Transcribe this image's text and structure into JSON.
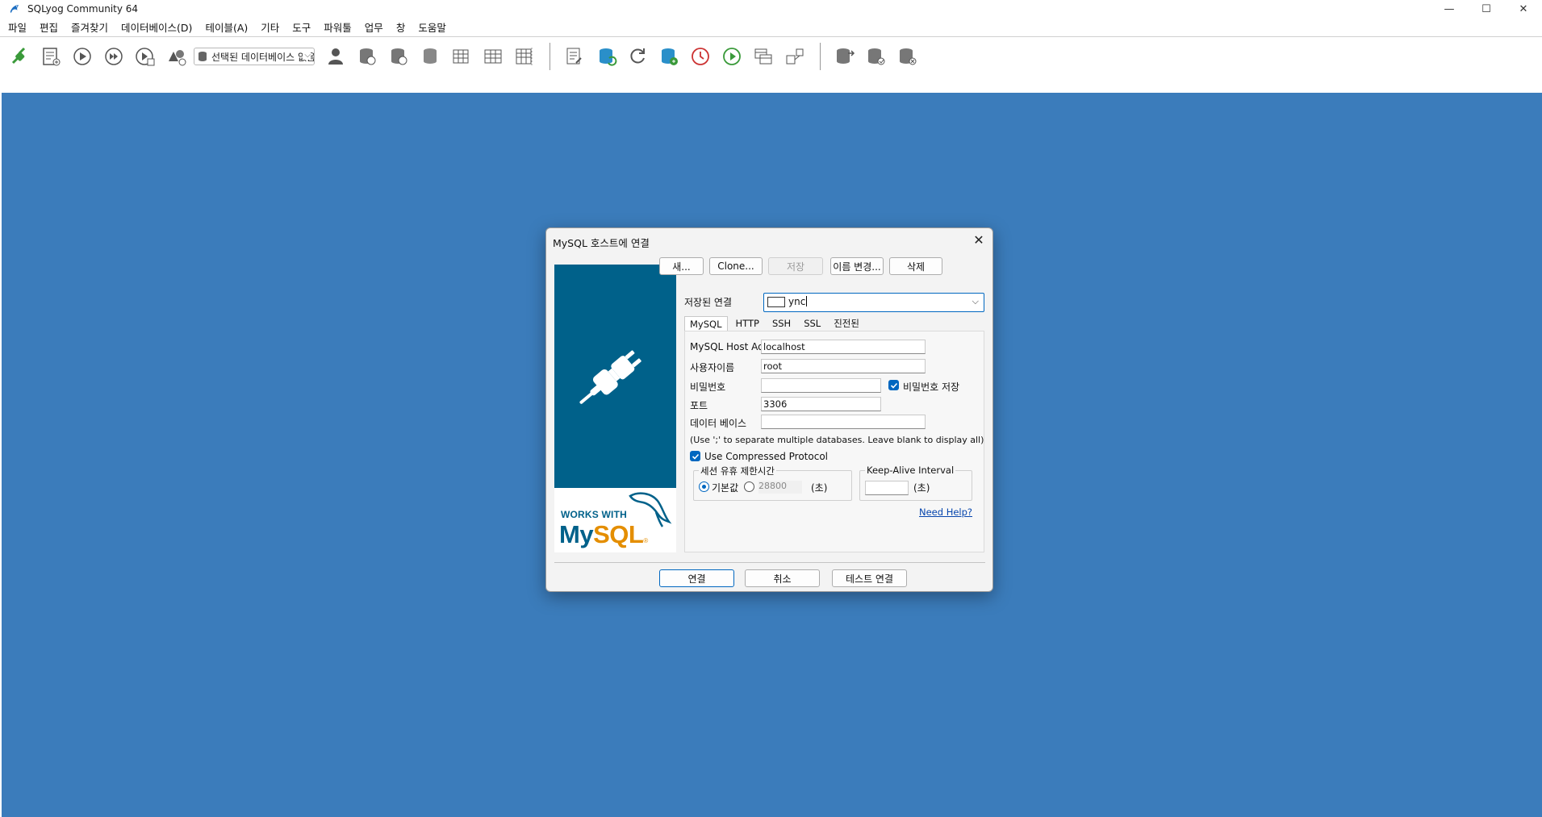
{
  "window": {
    "title": "SQLyog Community 64",
    "controls": {
      "minimize": "—",
      "maximize": "☐",
      "close": "✕"
    }
  },
  "menubar": {
    "items": [
      "파일",
      "편집",
      "즐겨찾기",
      "데이터베이스(D)",
      "테이블(A)",
      "기타",
      "도구",
      "파워툴",
      "업무",
      "창",
      "도움말"
    ]
  },
  "toolbar": {
    "db_selector": "선택된 데이터베이스 없음",
    "icons": [
      "connect-icon",
      "new-query-icon",
      "execute-icon",
      "execute-all-icon",
      "execute-edit-icon",
      "schema-designer-icon",
      "user-manager-icon",
      "backup-db-icon",
      "restore-db-icon",
      "copy-db-icon",
      "create-table-icon",
      "alter-table-icon",
      "manage-indexes-icon",
      "schema-sync-icon",
      "data-sync-icon",
      "refresh-icon",
      "import-external-icon",
      "scheduled-backup-icon",
      "sql-scheduler-icon",
      "query-builder-icon",
      "schema-optimizer-icon",
      "import-db-icon",
      "export-db-icon",
      "db-sync-icon"
    ]
  },
  "desktop": {
    "color": "#3b7cbb"
  },
  "dialog": {
    "title": "MySQL 호스트에 연결",
    "close": "✕",
    "logo": {
      "works_with": "WORKS WITH",
      "mysql_my": "My",
      "mysql_sql": "SQL",
      "trademark": "®"
    },
    "buttons": {
      "new": "새...",
      "clone": "Clone...",
      "save": "저장",
      "rename": "이름 변경...",
      "delete": "삭제"
    },
    "saved_connection": {
      "label": "저장된 연결",
      "value": "ync"
    },
    "tabs": [
      "MySQL",
      "HTTP",
      "SSH",
      "SSL",
      "진전된"
    ],
    "active_tab": "MySQL",
    "form": {
      "host_label": "MySQL Host Address",
      "host_value": "localhost",
      "user_label": "사용자이름",
      "user_value": "root",
      "password_label": "비밀번호",
      "password_value": "",
      "save_password_label": "비밀번호 저장",
      "save_password_checked": true,
      "port_label": "포트",
      "port_value": "3306",
      "database_label": "데이터 베이스",
      "database_value": "",
      "database_hint": "(Use ';' to separate multiple databases. Leave blank to display all)",
      "compressed_label": "Use Compressed Protocol",
      "compressed_checked": true,
      "session_group_title": "세션 유휴 제한시간",
      "session_default_label": "기본값",
      "session_value": "28800",
      "session_unit": "(초)",
      "keepalive_title": "Keep-Alive Interval",
      "keepalive_value": "",
      "keepalive_unit": "(초)",
      "help_link": "Need Help?"
    },
    "footer": {
      "connect": "연결",
      "cancel": "취소",
      "test": "테스트 연결"
    }
  },
  "colors": {
    "accent": "#0067c0",
    "mysql_blue": "#00618a",
    "mysql_orange": "#e48e00"
  }
}
